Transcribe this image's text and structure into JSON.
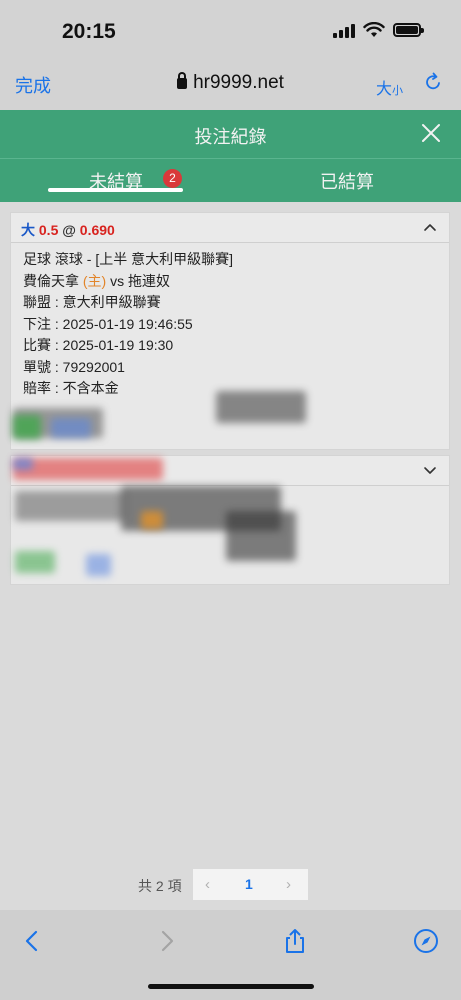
{
  "status_bar": {
    "time": "20:15"
  },
  "browser": {
    "done_label": "完成",
    "host": "hr9999.net",
    "text_size_big": "大",
    "text_size_small": "小"
  },
  "modal": {
    "title": "投注紀錄"
  },
  "tabs": {
    "unsettled_label": "未結算",
    "unsettled_count": "2",
    "settled_label": "已結算"
  },
  "bet1": {
    "selection": "大",
    "handicap": "0.5",
    "at": "@",
    "odds": "0.690",
    "market": "足球 滾球 - [上半 意大利甲級聯賽]",
    "home_team": "費倫天拿",
    "home_tag": "(主)",
    "vs": "vs",
    "away_team": "拖連奴",
    "league": "聯盟 : 意大利甲級聯賽",
    "placed": "下注 : 2025-01-19 19:46:55",
    "match_time": "比賽 : 2025-01-19 19:30",
    "ticket": "單號 : 79292001",
    "odds_type": "賠率 : 不含本金"
  },
  "pagination": {
    "total": "共 2 項",
    "prev": "‹",
    "page": "1",
    "next": "›"
  },
  "colors": {
    "header_green": "#3fa278",
    "accent_blue": "#1a73e8",
    "odds_red": "#d8231f",
    "badge_red": "#d9393a"
  }
}
